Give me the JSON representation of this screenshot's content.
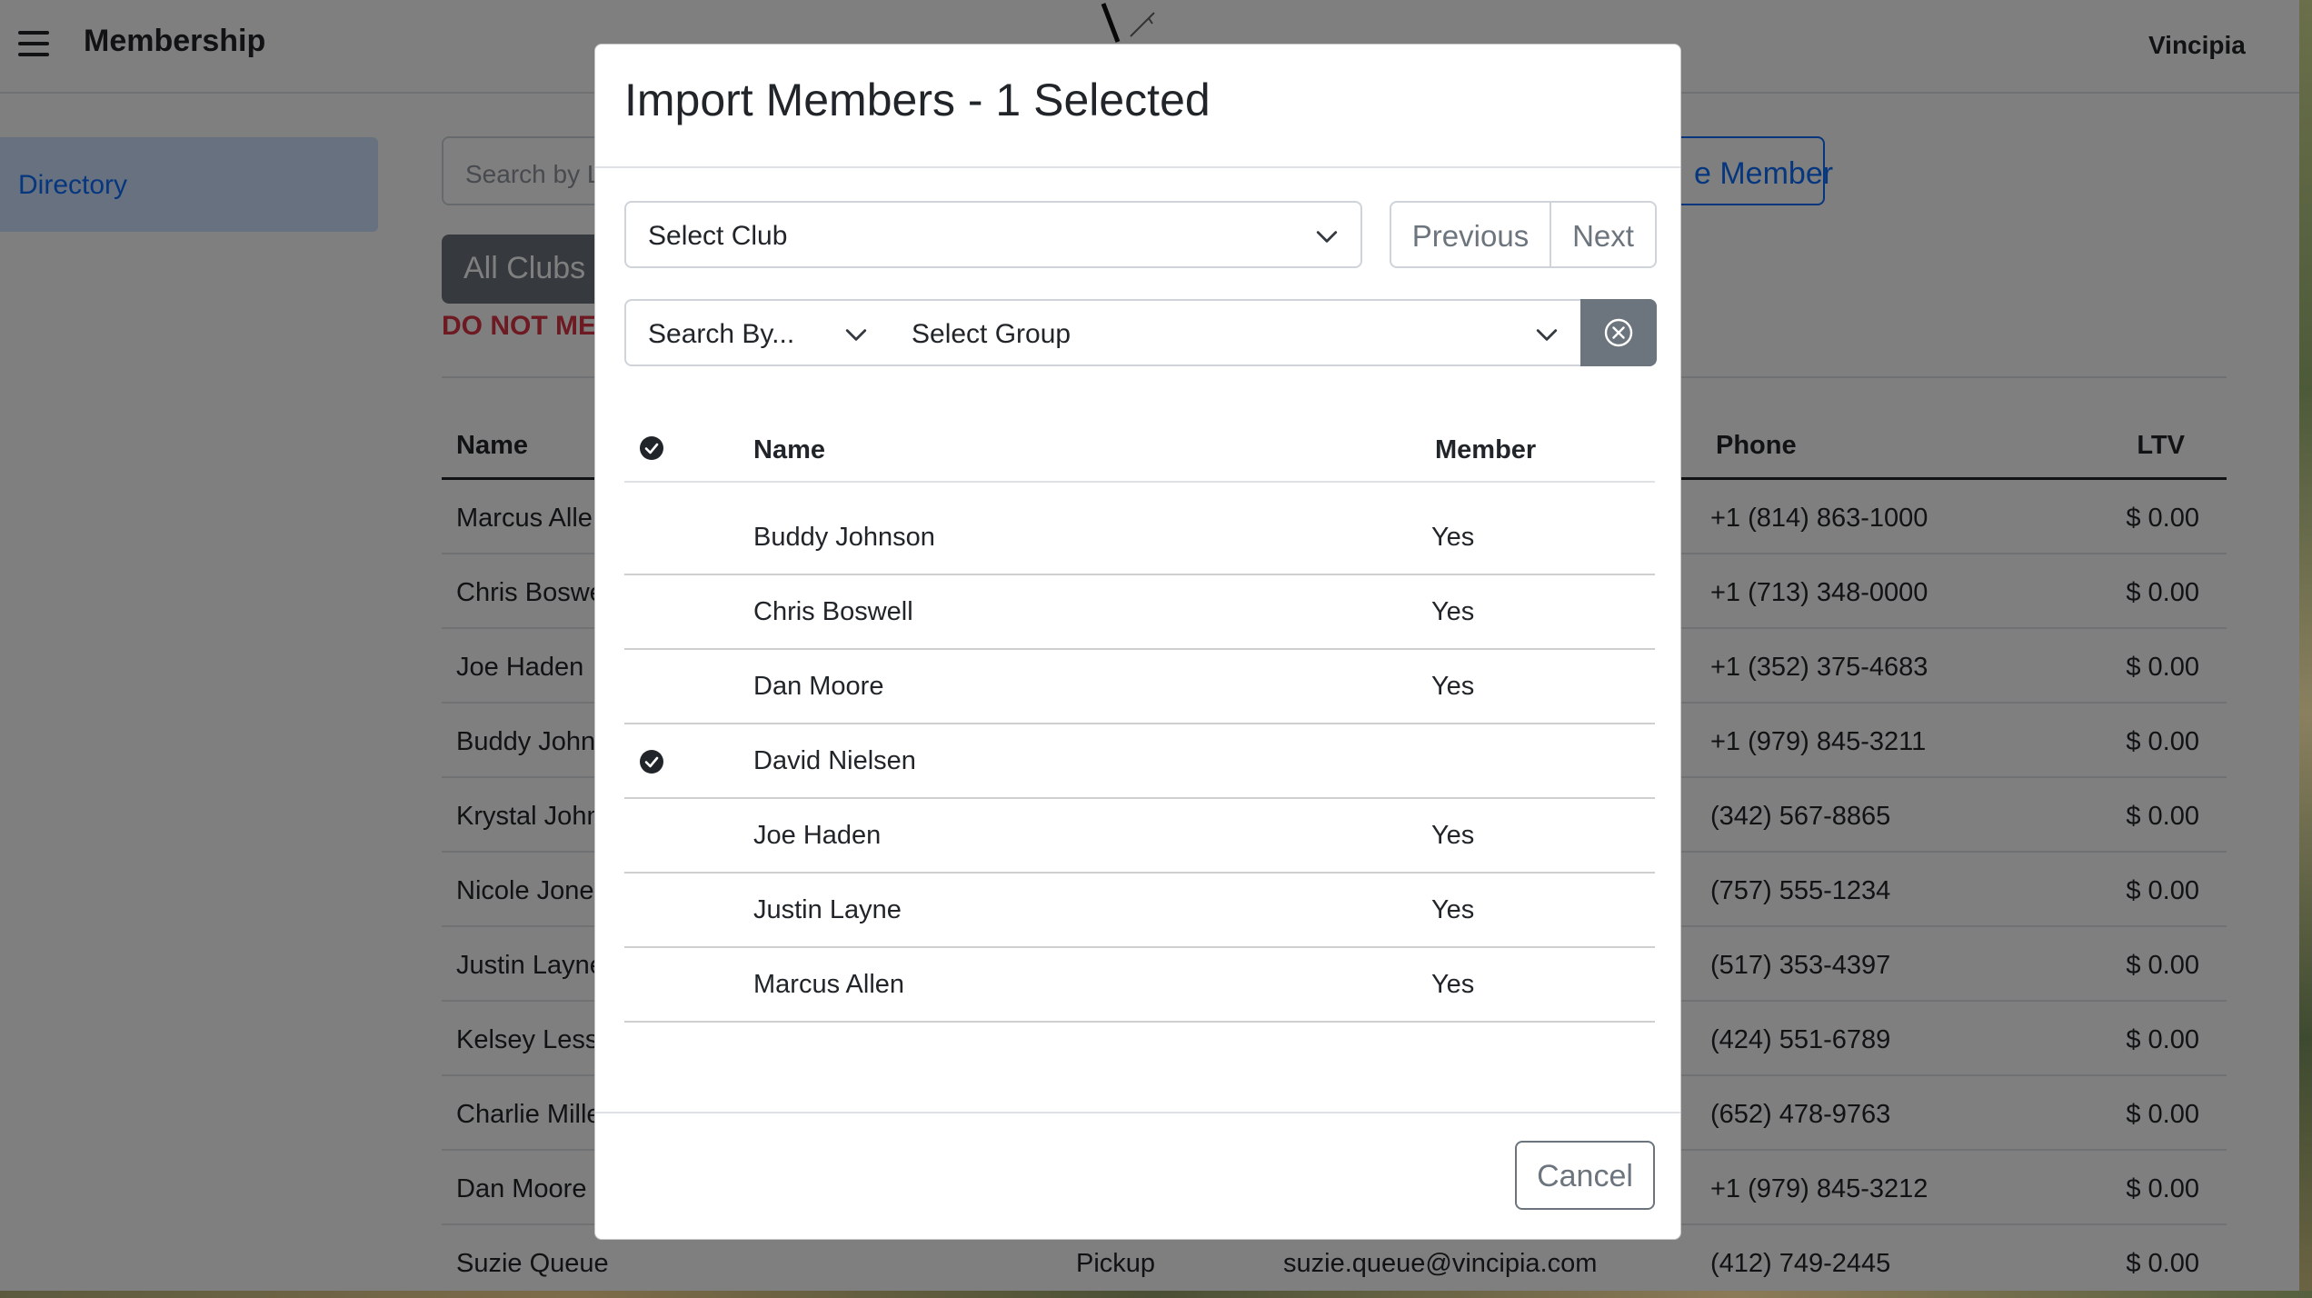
{
  "header": {
    "app_title": "Membership",
    "user_brand": "Vincipia"
  },
  "sidebar": {
    "items": [
      {
        "label": "Directory",
        "active": true
      }
    ]
  },
  "toolbar": {
    "search_placeholder": "Search by L",
    "add_member_label": "e Member",
    "clubs_filter_label": "All Clubs",
    "warning_text": "DO NOT MER"
  },
  "directory": {
    "columns": {
      "name": "Name",
      "phone": "Phone",
      "ltv": "LTV"
    },
    "rows": [
      {
        "name": "Marcus Alle",
        "type": "",
        "email": "",
        "phone": "+1 (814) 863-1000",
        "ltv": "$ 0.00"
      },
      {
        "name": "Chris Boswe",
        "type": "",
        "email": "",
        "phone": "+1 (713) 348-0000",
        "ltv": "$ 0.00"
      },
      {
        "name": "Joe Haden",
        "type": "",
        "email": "",
        "phone": "+1 (352) 375-4683",
        "ltv": "$ 0.00"
      },
      {
        "name": "Buddy John",
        "type": "",
        "email": "",
        "phone": "+1 (979) 845-3211",
        "ltv": "$ 0.00"
      },
      {
        "name": "Krystal John",
        "type": "",
        "email": "",
        "phone": "(342) 567-8865",
        "ltv": "$ 0.00"
      },
      {
        "name": "Nicole Jone",
        "type": "",
        "email": "",
        "phone": "(757) 555-1234",
        "ltv": "$ 0.00"
      },
      {
        "name": "Justin Layne",
        "type": "",
        "email": "",
        "phone": "(517) 353-4397",
        "ltv": "$ 0.00"
      },
      {
        "name": "Kelsey Less",
        "type": "",
        "email": "",
        "phone": "(424) 551-6789",
        "ltv": "$ 0.00"
      },
      {
        "name": "Charlie Mille",
        "type": "",
        "email": "",
        "phone": "(652) 478-9763",
        "ltv": "$ 0.00"
      },
      {
        "name": "Dan Moore",
        "type": "",
        "email": "",
        "phone": "+1 (979) 845-3212",
        "ltv": "$ 0.00"
      },
      {
        "name": "Suzie Queue",
        "type": "Pickup",
        "email": "suzie.queue@vincipia.com",
        "phone": "(412) 749-2445",
        "ltv": "$ 0.00"
      }
    ]
  },
  "modal": {
    "title": "Import Members - 1 Selected",
    "club_select": "Select Club",
    "previous_label": "Previous",
    "next_label": "Next",
    "search_by": "Search By...",
    "group_select": "Select Group",
    "columns": {
      "name": "Name",
      "member": "Member"
    },
    "rows": [
      {
        "name": "Buddy Johnson",
        "member": "Yes",
        "selected": false
      },
      {
        "name": "Chris Boswell",
        "member": "Yes",
        "selected": false
      },
      {
        "name": "Dan Moore",
        "member": "Yes",
        "selected": false
      },
      {
        "name": "David Nielsen",
        "member": "",
        "selected": true
      },
      {
        "name": "Joe Haden",
        "member": "Yes",
        "selected": false
      },
      {
        "name": "Justin Layne",
        "member": "Yes",
        "selected": false
      },
      {
        "name": "Marcus Allen",
        "member": "Yes",
        "selected": false
      }
    ],
    "cancel_label": "Cancel"
  },
  "colors": {
    "primary": "#0d6efd",
    "secondary": "#6c757d",
    "danger": "#dc3545",
    "nav_active_bg": "#cfe2ff"
  },
  "icons": {
    "menu": "hamburger-icon",
    "chevron": "chevron-down-icon",
    "clear": "circle-x-icon",
    "check": "check-circle-icon"
  }
}
